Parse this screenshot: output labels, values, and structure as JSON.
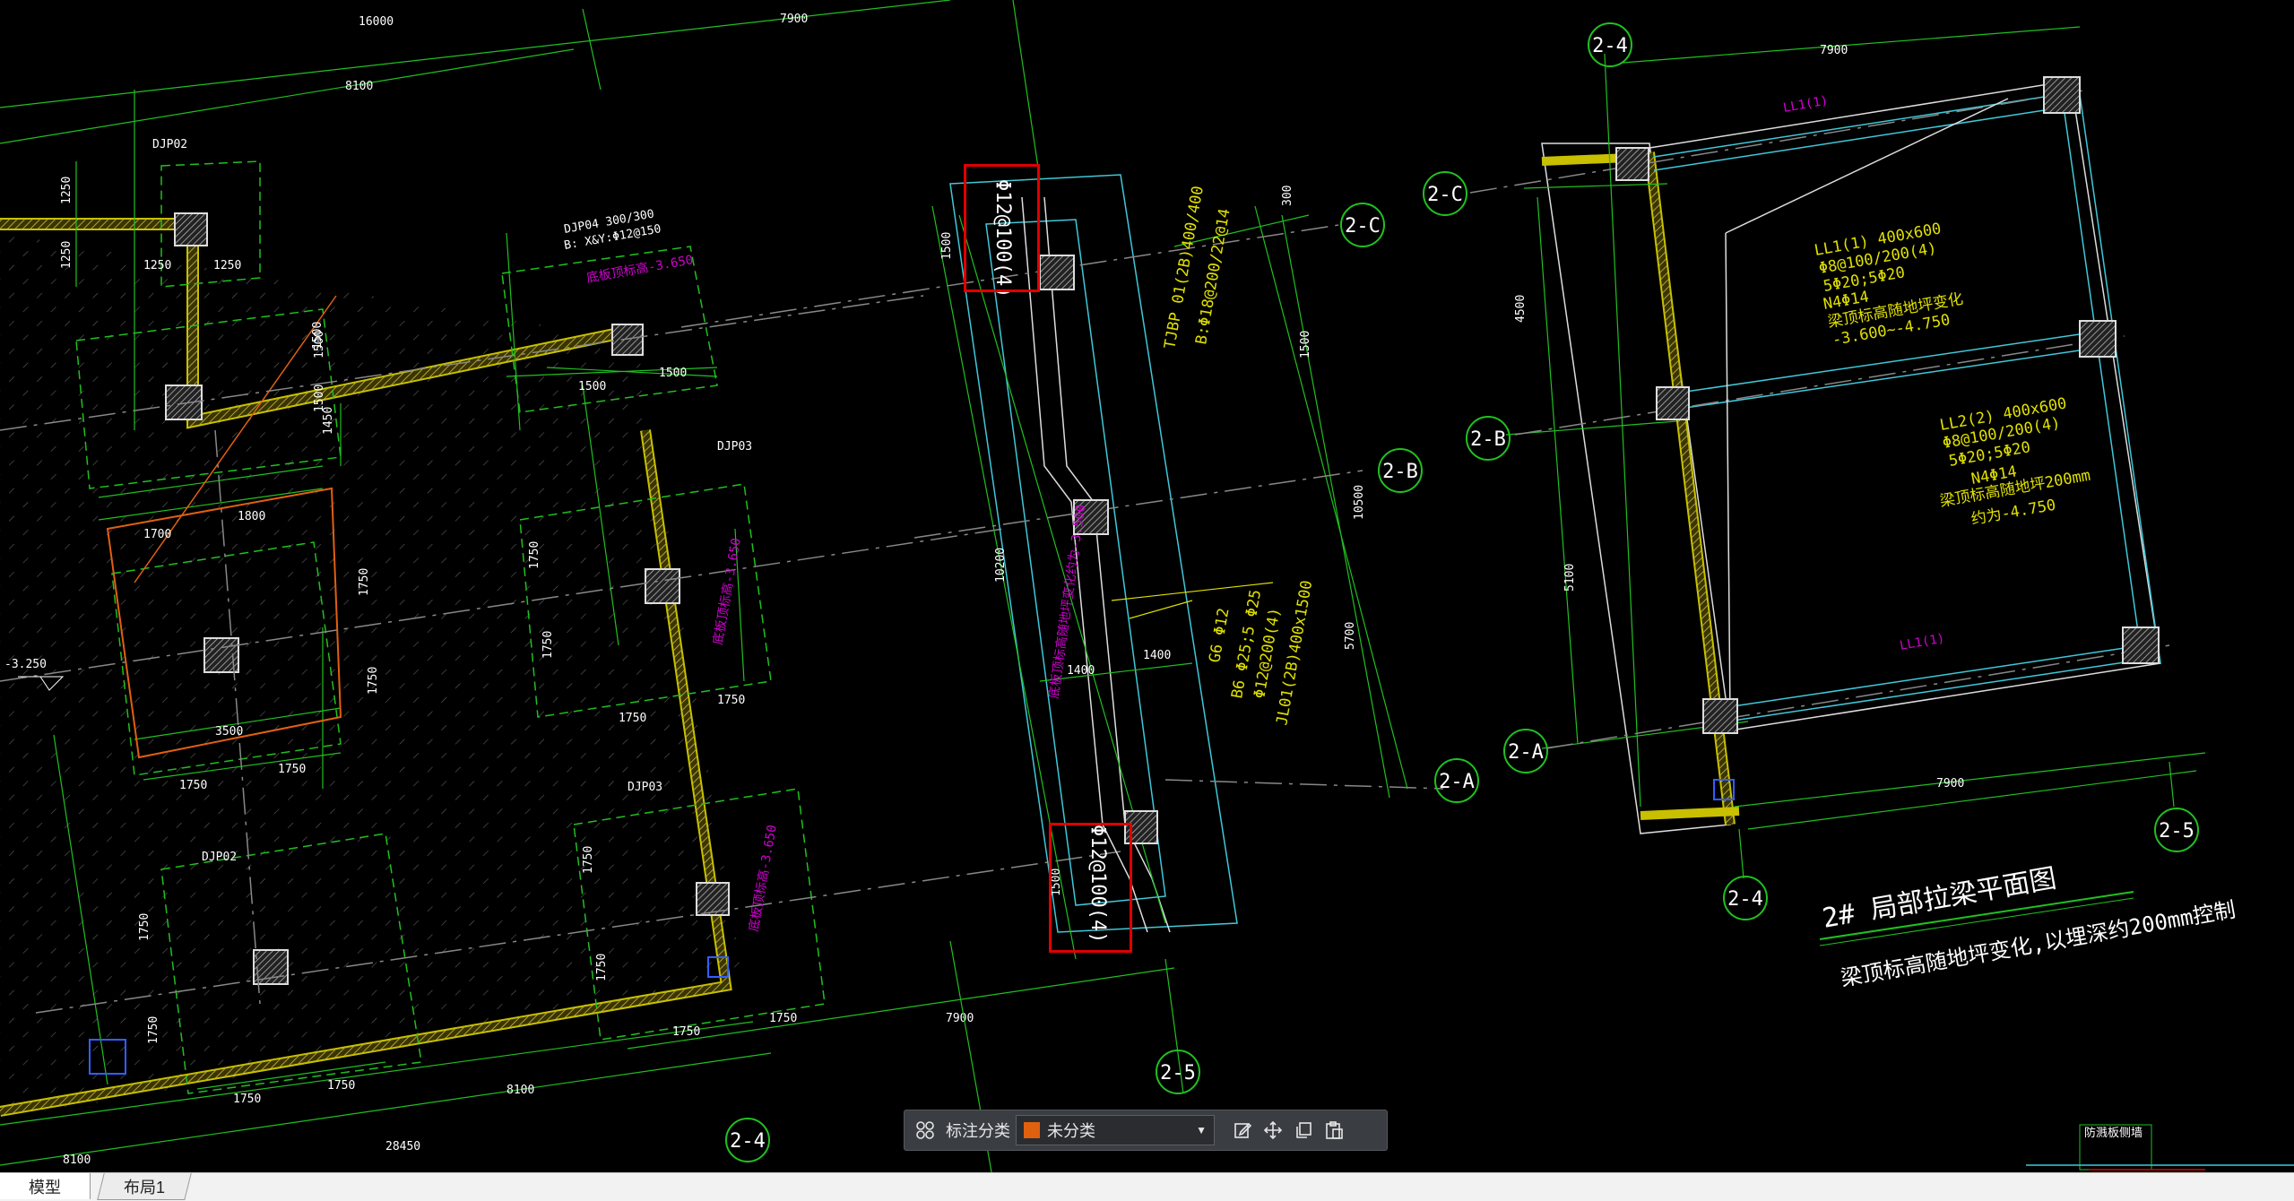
{
  "canvas": {
    "background": "#000000",
    "axis_labels": [
      "2-4",
      "2-C",
      "2-B",
      "2-A",
      "2-5"
    ],
    "dimensions": [
      "16000",
      "7900",
      "8100",
      "1250",
      "1250",
      "1250",
      "1500",
      "1500",
      "1500",
      "1500",
      "1500",
      "1450",
      "1700",
      "1800",
      "3500",
      "1750",
      "1750",
      "1750",
      "1750",
      "1750",
      "1750",
      "1750",
      "1750",
      "1750",
      "1400",
      "1400",
      "10200",
      "10500",
      "5700",
      "4500",
      "5100",
      "28450",
      "8100",
      "7900",
      "300"
    ],
    "pier_labels": {
      "djp02_a": "DJP02",
      "djp02_b": "DJP02",
      "djp03_a": "DJP03",
      "djp03_b": "DJP03",
      "djp04": "DJP04 300/300",
      "djp04_b": "B: X&Y:Φ12@150",
      "level": "-3.250"
    },
    "rebar_marks": {
      "top": "Φ12@100(4)",
      "bottom": "Φ12@100(4)"
    },
    "beams": {
      "tjbp": "TJBP 01(2B)400/400",
      "tjbp_b": "B:Φ18@200/22@14",
      "jl01_title": "JL01(2B)400x1500",
      "jl01_l1": "Φ12@200(4)",
      "jl01_l2": "B6 Φ25;5 Φ25",
      "jl01_l3": "G6 Φ12",
      "ll1_a": "LL1(1)",
      "ll1_b": "LL1(1)",
      "ll1_detail": [
        "LL1(1) 400x600",
        "Φ8@100/200(4)",
        "5Φ20;5Φ20",
        "N4Φ14",
        "梁顶标高随地坪变化",
        "-3.600~-4.750"
      ],
      "ll2_detail": [
        "LL2(2) 400x600",
        "Φ8@100/200(4)",
        "5Φ20;5Φ20",
        "N4Φ14",
        "梁顶标高随地坪200mm",
        "约为-4.750"
      ]
    },
    "drawing_title": "2# 局部拉梁平面图",
    "drawing_note": "梁顶标高随地坪变化,以埋深约200mm控制",
    "corner_text": "防溅板侧墙"
  },
  "annotation_toolbar": {
    "label": "标注分类",
    "selected": "未分类",
    "selected_color": "#e06010",
    "icons": [
      "grid-icon",
      "edit-icon",
      "move-icon",
      "copy-icon",
      "paste-icon"
    ]
  },
  "tabs": {
    "model": "模型",
    "layout1": "布局1"
  }
}
